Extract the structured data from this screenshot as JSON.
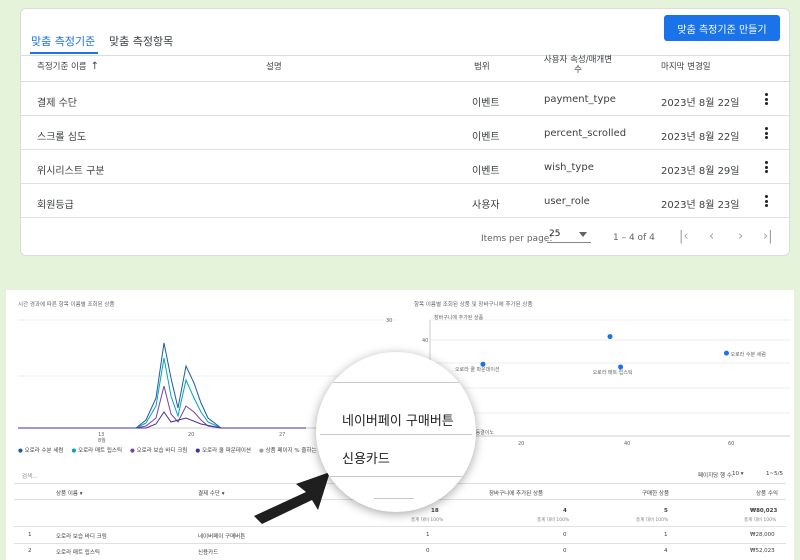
{
  "tabs": [
    {
      "label": "맞춤 측정기준"
    },
    {
      "label": "맞춤 측정항목"
    }
  ],
  "create_button": "맞춤 측정기준 만들기",
  "table": {
    "headers": {
      "name": "측정기준 이름",
      "name_sort": "↑",
      "description": "설명",
      "scope": "범위",
      "param_line1": "사용자 속성/매개변",
      "param_line2": "수",
      "last_modified": "마지막 변경일"
    },
    "rows": [
      {
        "name": "결제 수단",
        "scope": "이벤트",
        "param": "payment_type",
        "date": "2023년 8월 22일"
      },
      {
        "name": "스크롤 심도",
        "scope": "이벤트",
        "param": "percent_scrolled",
        "date": "2023년 8월 22일"
      },
      {
        "name": "위시리스트 구분",
        "scope": "이벤트",
        "param": "wish_type",
        "date": "2023년 8월 29일"
      },
      {
        "name": "회원등급",
        "scope": "사용자",
        "param": "user_role",
        "date": "2023년 8월 23일"
      }
    ]
  },
  "pagination": {
    "items_label": "Items per page:",
    "per_page": "25",
    "range": "1 – 4 of 4",
    "first": "|‹",
    "prev": "‹",
    "next": "›",
    "last": "›|"
  },
  "report": {
    "line_chart_title": "시간 경과에 따른 항목 이름별 조회된 상품",
    "scatter_title": "항목 이름별 조회된 상품 및 장바구니에 추가된 상품",
    "line_y_max": "30",
    "line_x_ticks": [
      "13",
      "20",
      "27"
    ],
    "line_x_month": "8월",
    "scatter_y_label": "장바구니에 추가된 상품",
    "scatter_y_tick": "40",
    "scatter_x_label": "항목 보기 여기상품 등결이노",
    "scatter_x_ticks": [
      "20",
      "40",
      "60"
    ],
    "scatter_points": [
      {
        "label": "",
        "x": 34,
        "y": 46
      },
      {
        "label": "오로라 쿨 파운데이션",
        "x": 10,
        "y": 36
      },
      {
        "label": "오로라 매트 립스틱",
        "x": 36,
        "y": 35
      },
      {
        "label": "오로라 수분 세럼",
        "x": 56,
        "y": 40
      }
    ],
    "legend": [
      "오로라 수분 세럼",
      "오로라 매트 립스틱",
      "오로라 보습 바디 크림",
      "오로라 쿨 파운데이션",
      "상품 페이지 % 줄하는 명백입니다 설물명이 % 줄하는"
    ],
    "search_placeholder": "검색...",
    "rows_per_page_label": "페이지당 행 수:",
    "rows_per_page": "10",
    "range": "1~5/5",
    "col_item": "상품 이름",
    "col_payment": "결제 수단",
    "col_cart": "장바구니에 추가된 상품",
    "col_purchase": "구매한 상품",
    "col_revenue": "상품 수익",
    "totals": {
      "a": "18",
      "b": "4",
      "c": "5",
      "revenue": "₩80,023"
    },
    "totals_sub": "총계 대비 100%",
    "rows": [
      {
        "idx": "1",
        "item": "오로라 보습 바디 크림",
        "payment": "네이버페이 구매버튼",
        "a": "1",
        "b": "0",
        "c": "1",
        "revenue": "₩28,000"
      },
      {
        "idx": "2",
        "item": "오로라 매트 립스틱",
        "payment": "신용카드",
        "a": "0",
        "b": "0",
        "c": "4",
        "revenue": "₩52,023"
      }
    ]
  },
  "magnifier": {
    "item1": "네이버페이 구매버튼",
    "item2": "신용카드"
  },
  "colors": {
    "accent": "#1a73e8",
    "outer_bg": "#e4f3d9",
    "line_series": [
      "#1b5e9e",
      "#00a3c4",
      "#7b3fb0",
      "#4a2c9a"
    ]
  }
}
